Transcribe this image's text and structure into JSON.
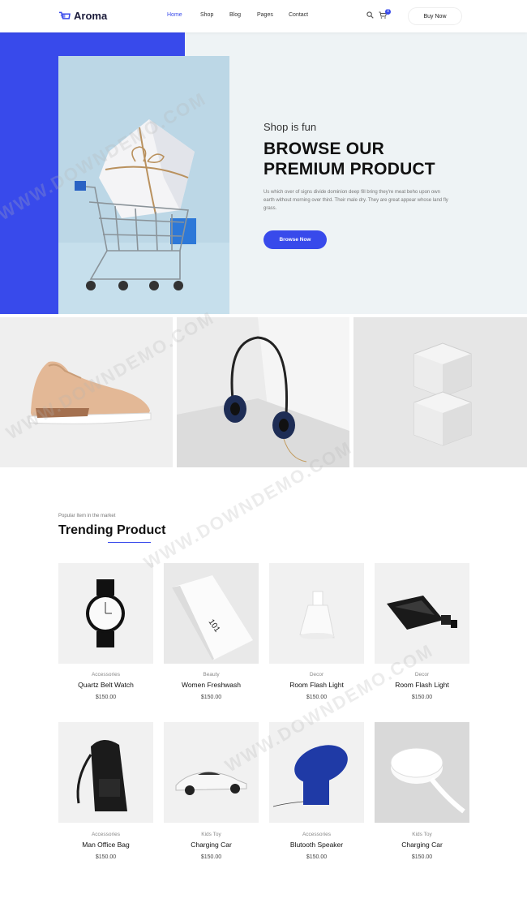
{
  "header": {
    "brand": "Aroma",
    "nav": [
      "Home",
      "Shop",
      "Blog",
      "Pages",
      "Contact"
    ],
    "cart_count": "0",
    "buy_label": "Buy Now"
  },
  "hero": {
    "subtitle": "Shop is fun",
    "title_line1": "BROWSE OUR",
    "title_line2": "PREMIUM PRODUCT",
    "description": "Us which over of signs divide dominion deep fill bring they're meat beho upon own earth without morning over third. Their male dry. They are great appear whose land fly grass.",
    "cta": "Browse Now"
  },
  "trending": {
    "subtitle": "Popular Item in the market",
    "title": "Trending Product",
    "products": [
      {
        "category": "Accessories",
        "name": "Quartz Belt Watch",
        "price": "$150.00"
      },
      {
        "category": "Beauty",
        "name": "Women Freshwash",
        "price": "$150.00"
      },
      {
        "category": "Decor",
        "name": "Room Flash Light",
        "price": "$150.00"
      },
      {
        "category": "Decor",
        "name": "Room Flash Light",
        "price": "$150.00"
      },
      {
        "category": "Accessories",
        "name": "Man Office Bag",
        "price": "$150.00"
      },
      {
        "category": "Kids Toy",
        "name": "Charging Car",
        "price": "$150.00"
      },
      {
        "category": "Accessories",
        "name": "Blutooth Speaker",
        "price": "$150.00"
      },
      {
        "category": "Kids Toy",
        "name": "Charging Car",
        "price": "$150.00"
      }
    ]
  },
  "watermark": "WWW.DOWNDEMO.COM",
  "colors": {
    "accent": "#384aeb",
    "hero_bg": "#eef3f5"
  }
}
